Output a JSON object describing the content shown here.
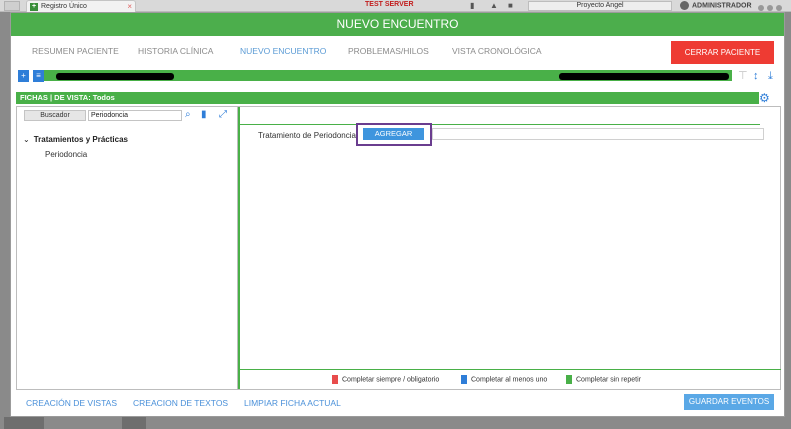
{
  "browser": {
    "tab_title": "Registro Único",
    "tab_favicon": "+",
    "tab_close": "×",
    "server_label": "TEST SERVER",
    "project_label": "Proyecto Angel",
    "user_label": "ADMINISTRADOR"
  },
  "modal": {
    "title": "NUEVO ENCUENTRO",
    "tabs": [
      {
        "label": "RESUMEN PACIENTE"
      },
      {
        "label": "HISTORIA CLÍNICA"
      },
      {
        "label": "NUEVO ENCUENTRO"
      },
      {
        "label": "PROBLEMAS/HILOS"
      },
      {
        "label": "VISTA CRONOLÓGICA"
      }
    ],
    "active_tab": "NUEVO ENCUENTRO",
    "close_button": "CERRAR PACIENTE"
  },
  "fichas": {
    "title": "FICHAS | DE VISTA: Todos",
    "search_label": "Buscador",
    "search_value": "Periodoncia",
    "tree": {
      "group": "Tratamientos y Prácticas",
      "items": [
        "Periodoncia"
      ]
    }
  },
  "form": {
    "field_label": "Tratamiento de Periodoncia",
    "add_button": "AGREGAR"
  },
  "legend": [
    {
      "label": "Completar siempre / obligatorio",
      "color": "#e84c4c"
    },
    {
      "label": "Completar al menos uno",
      "color": "#2f7ed8"
    },
    {
      "label": "Completar sin repetir",
      "color": "#49b048"
    }
  ],
  "footer": {
    "links": [
      "CREACIÓN DE VISTAS",
      "CREACION DE TEXTOS",
      "LIMPIAR FICHA ACTUAL"
    ],
    "save_button": "GUARDAR EVENTOS"
  },
  "colors": {
    "accent_green": "#4cae4c",
    "accent_blue": "#2f7ed8",
    "danger": "#ee3b33"
  },
  "icons": {
    "patient_doc": "document-icon",
    "patient_book": "book-icon",
    "search": "search-icon",
    "delete": "trash-icon",
    "expand": "expand-icon",
    "settings": "gear-icon"
  }
}
